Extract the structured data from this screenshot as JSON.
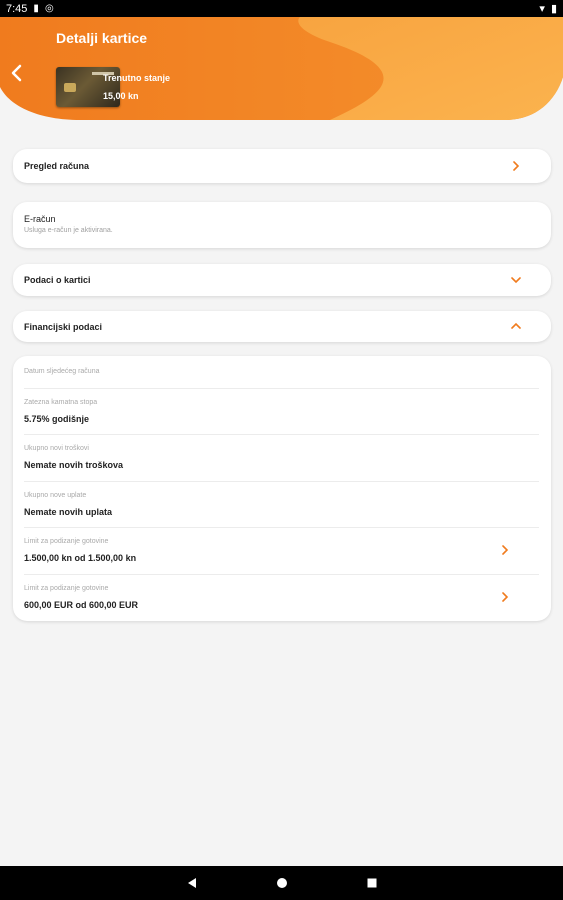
{
  "status_bar": {
    "time": "7:45"
  },
  "header": {
    "title": "Detalji kartice",
    "balance_label": "Trenutno stanje",
    "balance_value": "15,00 kn"
  },
  "rows": {
    "account_overview": "Pregled računa",
    "ebill_title": "E-račun",
    "ebill_sub": "Usluga e-račun je aktivirana.",
    "card_data": "Podaci o kartici",
    "financial_data": "Financijski podaci"
  },
  "financial": [
    {
      "key": "Datum sljedećeg računa",
      "value": ""
    },
    {
      "key": "Zatezna kamatna stopa",
      "value": "5.75% godišnje"
    },
    {
      "key": "Ukupno novi troškovi",
      "value": "Nemate novih troškova"
    },
    {
      "key": "Ukupno nove uplate",
      "value": "Nemate novih uplata"
    },
    {
      "key": "Limit za podizanje gotovine",
      "value": "1.500,00 kn od 1.500,00 kn"
    },
    {
      "key": "Limit za podizanje gotovine",
      "value": "600,00 EUR od 600,00 EUR"
    }
  ],
  "colors": {
    "accent": "#f07b1e",
    "accent_light": "#f9a640"
  }
}
